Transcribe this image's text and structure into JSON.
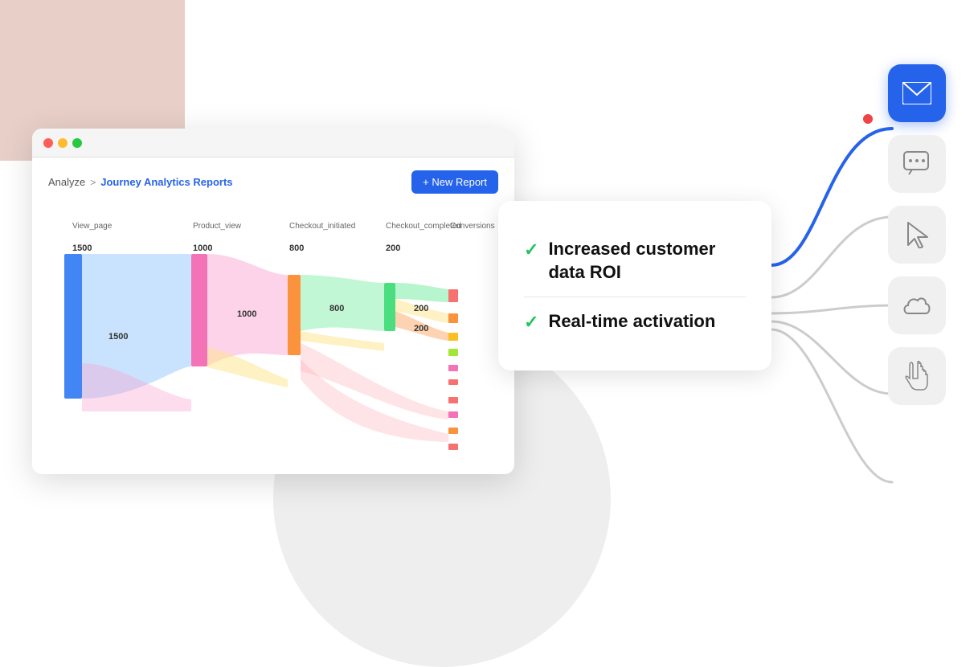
{
  "background": {
    "pink_rect_color": "#e8d0c8",
    "gray_circle_color": "#eeeeee"
  },
  "browser": {
    "titlebar": {
      "traffic_lights": [
        "#ff5f57",
        "#febc2e",
        "#28c840"
      ]
    },
    "breadcrumb": {
      "analyze": "Analyze",
      "chevron": ">",
      "current": "Journey Analytics Reports"
    },
    "new_report_btn": "+ New Report"
  },
  "sankey": {
    "nodes": [
      {
        "label": "View_page",
        "value": "1500"
      },
      {
        "label": "Product_view",
        "value": "1000"
      },
      {
        "label": "Checkout_initiated",
        "value": "800"
      },
      {
        "label": "Checkout_completed",
        "value": "200"
      },
      {
        "label": "Conversions",
        "value": ""
      }
    ],
    "values": {
      "v1": "1500",
      "v2": "1000",
      "v3": "800",
      "v4": "200",
      "v5": "200",
      "v6": "1000",
      "v7": "800"
    }
  },
  "info_card": {
    "item1": {
      "check": "✓",
      "text": "Increased customer data ROI"
    },
    "item2": {
      "check": "✓",
      "text": "Real-time activation"
    }
  },
  "icons": [
    {
      "name": "email",
      "symbol": "✉",
      "active": true
    },
    {
      "name": "chat",
      "symbol": "💬",
      "active": false
    },
    {
      "name": "cursor",
      "symbol": "↖",
      "active": false
    },
    {
      "name": "cloud",
      "symbol": "☁",
      "active": false
    },
    {
      "name": "pointer",
      "symbol": "☞",
      "active": false
    }
  ]
}
